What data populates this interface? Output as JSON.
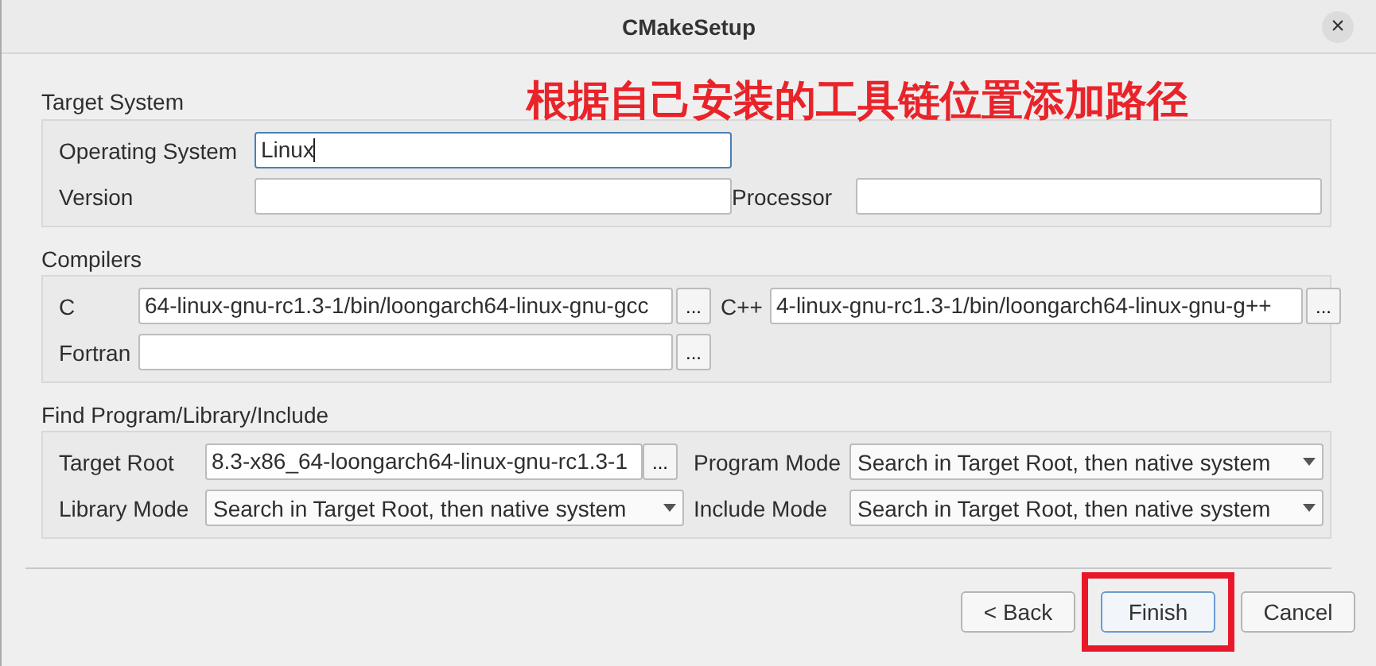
{
  "window": {
    "title": "CMakeSetup",
    "close": "×"
  },
  "annotation": {
    "text": "根据自己安装的工具链位置添加路径"
  },
  "target_system": {
    "title": "Target System",
    "operating_system": {
      "label": "Operating System",
      "value": "Linux",
      "focused": true
    },
    "version": {
      "label": "Version"
    },
    "processor": {
      "label": "Processor"
    }
  },
  "compilers": {
    "title": "Compilers",
    "c": {
      "label": "C",
      "value": "64-linux-gnu-rc1.3-1/bin/loongarch64-linux-gnu-gcc",
      "browse": "..."
    },
    "cxx": {
      "label": "C++",
      "value": "4-linux-gnu-rc1.3-1/bin/loongarch64-linux-gnu-g++",
      "browse": "..."
    },
    "fortran": {
      "label": "Fortran",
      "browse": "..."
    }
  },
  "find": {
    "title": "Find Program/Library/Include",
    "target_root": {
      "label": "Target Root",
      "value": "8.3-x86_64-loongarch64-linux-gnu-rc1.3-1",
      "browse": "..."
    },
    "program_mode": {
      "label": "Program Mode",
      "value": "Search in Target Root, then native system"
    },
    "library_mode": {
      "label": "Library Mode",
      "value": "Search in Target Root, then native system"
    },
    "include_mode": {
      "label": "Include Mode",
      "value": "Search in Target Root, then native system"
    }
  },
  "buttons": [
    {
      "label": "< Back",
      "default": false,
      "highlighted": false
    },
    {
      "label": "Finish",
      "default": true,
      "highlighted": true
    },
    {
      "label": "Cancel",
      "default": false,
      "highlighted": false
    }
  ]
}
